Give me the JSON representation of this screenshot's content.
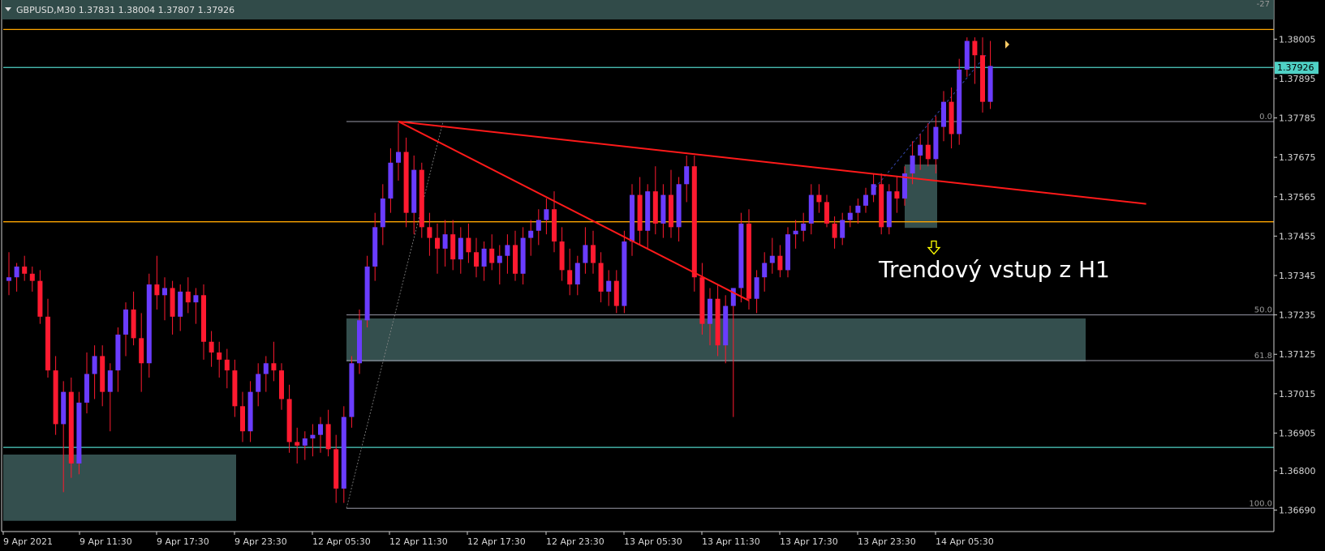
{
  "header": {
    "symbol_info": "GBPUSD,M30  1.37831 1.38004 1.37807 1.37926",
    "level_top_label": "-27"
  },
  "price_tag": "1.37926",
  "annotation_text": "Trendový vstup z H1",
  "colors": {
    "background": "#000000",
    "bull": "#6a3cff",
    "bear": "#ff1a30",
    "wick": "#ff1a30",
    "zone": "#3a5856",
    "level_orange": "#ffa500",
    "level_teal": "#4fd1c5",
    "fib_line": "#9a9aa8",
    "trendline": "#ff1a1a",
    "arrow": "#ffff00",
    "price_tag_bg": "#4fd1c5"
  },
  "chart_data": {
    "type": "candlestick",
    "instrument": "GBPUSD",
    "timeframe": "M30",
    "ylim": [
      1.3663,
      1.3806
    ],
    "y_ticks": [
      "1.38005",
      "1.37895",
      "1.37785",
      "1.37675",
      "1.37565",
      "1.37455",
      "1.37345",
      "1.37235",
      "1.37125",
      "1.37015",
      "1.36905",
      "1.36800",
      "1.36690"
    ],
    "x_ticks": [
      "9 Apr 2021",
      "9 Apr 11:30",
      "9 Apr 17:30",
      "9 Apr 23:30",
      "12 Apr 05:30",
      "12 Apr 11:30",
      "12 Apr 17:30",
      "12 Apr 23:30",
      "13 Apr 05:30",
      "13 Apr 11:30",
      "13 Apr 17:30",
      "13 Apr 23:30",
      "14 Apr 05:30"
    ],
    "horizontal_levels": [
      {
        "price": 1.38032,
        "color": "orange"
      },
      {
        "price": 1.37495,
        "color": "orange"
      },
      {
        "price": 1.37926,
        "color": "teal"
      },
      {
        "price": 1.36865,
        "color": "teal"
      }
    ],
    "fibonacci": {
      "high": 1.37775,
      "low": 1.36695,
      "labels": [
        "0.0",
        "50.0",
        "61.8",
        "100.0"
      ]
    },
    "zones": [
      {
        "from": 1.37225,
        "to": 1.37105
      },
      {
        "from": 1.36845,
        "to": 1.3666
      },
      {
        "from": 1.37655,
        "to": 1.37478
      }
    ],
    "candles": [
      [
        1.3733,
        1.3741,
        1.3729,
        1.3734
      ],
      [
        1.3734,
        1.3738,
        1.373,
        1.3737
      ],
      [
        1.3737,
        1.374,
        1.3733,
        1.3735
      ],
      [
        1.3735,
        1.3737,
        1.373,
        1.3733
      ],
      [
        1.3733,
        1.3736,
        1.3721,
        1.3723
      ],
      [
        1.3723,
        1.3728,
        1.3706,
        1.3708
      ],
      [
        1.3708,
        1.3712,
        1.369,
        1.3693
      ],
      [
        1.3693,
        1.3705,
        1.3674,
        1.3702
      ],
      [
        1.3702,
        1.3706,
        1.3678,
        1.3682
      ],
      [
        1.3682,
        1.3702,
        1.3679,
        1.3699
      ],
      [
        1.3699,
        1.3713,
        1.3696,
        1.3707
      ],
      [
        1.3707,
        1.3715,
        1.37,
        1.3712
      ],
      [
        1.3712,
        1.3715,
        1.3698,
        1.3702
      ],
      [
        1.3702,
        1.371,
        1.3691,
        1.3708
      ],
      [
        1.3708,
        1.372,
        1.3702,
        1.3718
      ],
      [
        1.3718,
        1.3727,
        1.3712,
        1.3725
      ],
      [
        1.3725,
        1.373,
        1.3715,
        1.3717
      ],
      [
        1.3717,
        1.3724,
        1.3702,
        1.371
      ],
      [
        1.371,
        1.3735,
        1.3706,
        1.3732
      ],
      [
        1.3732,
        1.374,
        1.3725,
        1.3729
      ],
      [
        1.3729,
        1.3734,
        1.3722,
        1.3731
      ],
      [
        1.3731,
        1.3733,
        1.3718,
        1.3723
      ],
      [
        1.3723,
        1.3732,
        1.3719,
        1.373
      ],
      [
        1.373,
        1.3734,
        1.3724,
        1.3727
      ],
      [
        1.3727,
        1.3731,
        1.3721,
        1.3729
      ],
      [
        1.3729,
        1.3732,
        1.3711,
        1.3716
      ],
      [
        1.3716,
        1.3719,
        1.3709,
        1.3713
      ],
      [
        1.3713,
        1.3716,
        1.3706,
        1.3711
      ],
      [
        1.3711,
        1.3714,
        1.3703,
        1.3708
      ],
      [
        1.3708,
        1.3711,
        1.3695,
        1.3698
      ],
      [
        1.3698,
        1.3702,
        1.3688,
        1.3691
      ],
      [
        1.3691,
        1.3705,
        1.3688,
        1.3702
      ],
      [
        1.3702,
        1.371,
        1.3698,
        1.3707
      ],
      [
        1.3707,
        1.3712,
        1.3702,
        1.371
      ],
      [
        1.371,
        1.3716,
        1.3705,
        1.3708
      ],
      [
        1.3708,
        1.371,
        1.3697,
        1.37
      ],
      [
        1.37,
        1.3704,
        1.3685,
        1.3688
      ],
      [
        1.3688,
        1.3692,
        1.3682,
        1.3687
      ],
      [
        1.3687,
        1.3691,
        1.3683,
        1.3689
      ],
      [
        1.3689,
        1.3693,
        1.3684,
        1.369
      ],
      [
        1.369,
        1.3695,
        1.3685,
        1.3693
      ],
      [
        1.3693,
        1.3697,
        1.3684,
        1.3686
      ],
      [
        1.3686,
        1.369,
        1.3671,
        1.3675
      ],
      [
        1.3675,
        1.3698,
        1.3671,
        1.3695
      ],
      [
        1.3695,
        1.3712,
        1.3692,
        1.371
      ],
      [
        1.371,
        1.3725,
        1.3707,
        1.3722
      ],
      [
        1.3722,
        1.374,
        1.372,
        1.3737
      ],
      [
        1.3737,
        1.3752,
        1.3733,
        1.3748
      ],
      [
        1.3748,
        1.376,
        1.3743,
        1.3756
      ],
      [
        1.3756,
        1.377,
        1.3752,
        1.3766
      ],
      [
        1.3766,
        1.3777,
        1.3761,
        1.3769
      ],
      [
        1.3769,
        1.3773,
        1.3748,
        1.3752
      ],
      [
        1.3752,
        1.3768,
        1.3746,
        1.3764
      ],
      [
        1.3764,
        1.3766,
        1.3745,
        1.3748
      ],
      [
        1.3748,
        1.3752,
        1.374,
        1.3745
      ],
      [
        1.3745,
        1.3749,
        1.3735,
        1.3742
      ],
      [
        1.3742,
        1.375,
        1.3737,
        1.3746
      ],
      [
        1.3746,
        1.375,
        1.3736,
        1.3739
      ],
      [
        1.3739,
        1.3748,
        1.3735,
        1.3745
      ],
      [
        1.3745,
        1.3749,
        1.3738,
        1.3741
      ],
      [
        1.3741,
        1.3745,
        1.3734,
        1.3737
      ],
      [
        1.3737,
        1.3744,
        1.3733,
        1.3742
      ],
      [
        1.3742,
        1.3746,
        1.3736,
        1.3738
      ],
      [
        1.3738,
        1.3743,
        1.3732,
        1.374
      ],
      [
        1.374,
        1.3746,
        1.3735,
        1.3743
      ],
      [
        1.3743,
        1.3747,
        1.3733,
        1.3735
      ],
      [
        1.3735,
        1.3748,
        1.3732,
        1.3745
      ],
      [
        1.3745,
        1.375,
        1.374,
        1.3747
      ],
      [
        1.3747,
        1.3753,
        1.3743,
        1.375
      ],
      [
        1.375,
        1.3756,
        1.3746,
        1.3753
      ],
      [
        1.3753,
        1.3758,
        1.3741,
        1.3744
      ],
      [
        1.3744,
        1.3748,
        1.3733,
        1.3736
      ],
      [
        1.3736,
        1.3742,
        1.3729,
        1.3732
      ],
      [
        1.3732,
        1.374,
        1.3729,
        1.3738
      ],
      [
        1.3738,
        1.3748,
        1.3735,
        1.3743
      ],
      [
        1.3743,
        1.3747,
        1.3735,
        1.3738
      ],
      [
        1.3738,
        1.3741,
        1.3727,
        1.373
      ],
      [
        1.373,
        1.3736,
        1.3726,
        1.3733
      ],
      [
        1.3733,
        1.3736,
        1.3724,
        1.3726
      ],
      [
        1.3726,
        1.3747,
        1.3724,
        1.3744
      ],
      [
        1.3744,
        1.376,
        1.374,
        1.3757
      ],
      [
        1.3757,
        1.3762,
        1.3743,
        1.3747
      ],
      [
        1.3747,
        1.376,
        1.3742,
        1.3758
      ],
      [
        1.3758,
        1.3765,
        1.3746,
        1.3749
      ],
      [
        1.3749,
        1.376,
        1.3745,
        1.3757
      ],
      [
        1.3757,
        1.3764,
        1.3745,
        1.3748
      ],
      [
        1.3748,
        1.3762,
        1.3744,
        1.376
      ],
      [
        1.376,
        1.3768,
        1.3755,
        1.3765
      ],
      [
        1.3765,
        1.3768,
        1.373,
        1.3734
      ],
      [
        1.3734,
        1.3738,
        1.3718,
        1.3721
      ],
      [
        1.3721,
        1.3731,
        1.3715,
        1.3728
      ],
      [
        1.3728,
        1.3732,
        1.3712,
        1.3715
      ],
      [
        1.3715,
        1.3729,
        1.371,
        1.3726
      ],
      [
        1.3726,
        1.373,
        1.3695,
        1.3731
      ],
      [
        1.3731,
        1.3752,
        1.3727,
        1.3749
      ],
      [
        1.3749,
        1.3753,
        1.3725,
        1.3728
      ],
      [
        1.3728,
        1.3736,
        1.3724,
        1.3734
      ],
      [
        1.3734,
        1.3741,
        1.373,
        1.3738
      ],
      [
        1.3738,
        1.3745,
        1.3735,
        1.374
      ],
      [
        1.374,
        1.3743,
        1.3734,
        1.3736
      ],
      [
        1.3736,
        1.3748,
        1.3734,
        1.3746
      ],
      [
        1.3746,
        1.375,
        1.3742,
        1.3747
      ],
      [
        1.3747,
        1.3752,
        1.3744,
        1.3749
      ],
      [
        1.3749,
        1.376,
        1.3746,
        1.3757
      ],
      [
        1.3757,
        1.376,
        1.3752,
        1.3755
      ],
      [
        1.3755,
        1.3757,
        1.3748,
        1.3749
      ],
      [
        1.3749,
        1.3751,
        1.3742,
        1.3745
      ],
      [
        1.3745,
        1.3752,
        1.3743,
        1.375
      ],
      [
        1.375,
        1.3754,
        1.3748,
        1.3752
      ],
      [
        1.3752,
        1.3756,
        1.3749,
        1.3754
      ],
      [
        1.3754,
        1.3759,
        1.3752,
        1.3757
      ],
      [
        1.3757,
        1.3763,
        1.3755,
        1.376
      ],
      [
        1.376,
        1.3763,
        1.3746,
        1.3748
      ],
      [
        1.3748,
        1.376,
        1.3746,
        1.3758
      ],
      [
        1.3758,
        1.3762,
        1.3752,
        1.3756
      ],
      [
        1.3756,
        1.3765,
        1.3754,
        1.3763
      ],
      [
        1.3763,
        1.3772,
        1.376,
        1.3768
      ],
      [
        1.3768,
        1.3774,
        1.3764,
        1.3771
      ],
      [
        1.3771,
        1.3777,
        1.3765,
        1.3767
      ],
      [
        1.3767,
        1.3779,
        1.3763,
        1.3776
      ],
      [
        1.3776,
        1.3786,
        1.3772,
        1.3783
      ],
      [
        1.3783,
        1.3787,
        1.377,
        1.3774
      ],
      [
        1.3774,
        1.3795,
        1.3771,
        1.3792
      ],
      [
        1.3792,
        1.3801,
        1.379,
        1.38
      ],
      [
        1.38,
        1.3801,
        1.3788,
        1.3796
      ],
      [
        1.3796,
        1.3801,
        1.378,
        1.3783
      ],
      [
        1.3783,
        1.38,
        1.3781,
        1.3793
      ]
    ],
    "trendlines": [
      {
        "from": {
          "candle": 50,
          "price": 1.37775
        },
        "to": {
          "candle": 146,
          "price": 1.37545
        }
      },
      {
        "from": {
          "candle": 50,
          "price": 1.37775
        },
        "to": {
          "candle": 95,
          "price": 1.37275
        }
      }
    ],
    "entry_arrow": {
      "candle": 130,
      "price": 1.37405
    }
  }
}
